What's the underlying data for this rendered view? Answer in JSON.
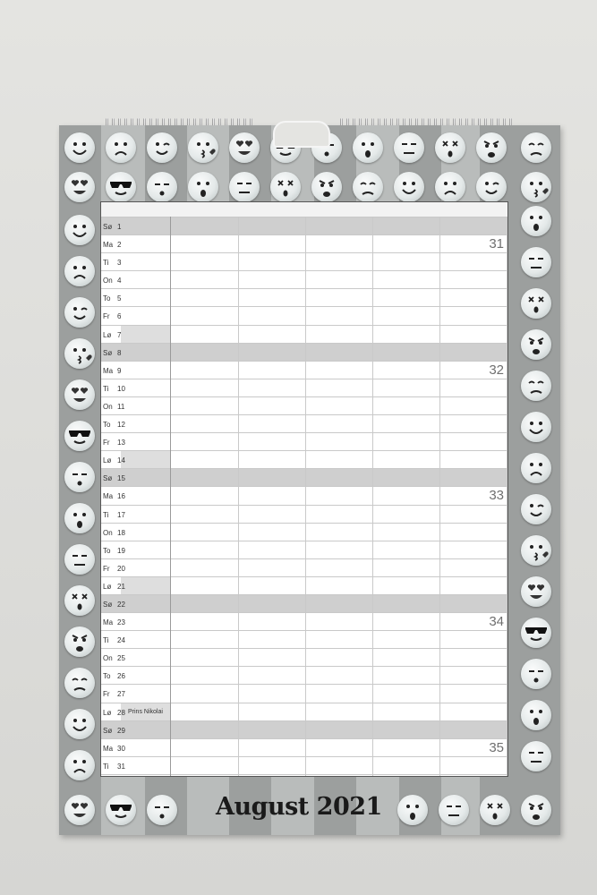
{
  "calendar": {
    "month_title": "August 2021",
    "days": [
      {
        "name": "Sø",
        "num": "1"
      },
      {
        "name": "Ma",
        "num": "2"
      },
      {
        "name": "Ti",
        "num": "3"
      },
      {
        "name": "On",
        "num": "4"
      },
      {
        "name": "To",
        "num": "5"
      },
      {
        "name": "Fr",
        "num": "6"
      },
      {
        "name": "Lø",
        "num": "7"
      },
      {
        "name": "Sø",
        "num": "8"
      },
      {
        "name": "Ma",
        "num": "9"
      },
      {
        "name": "Ti",
        "num": "10"
      },
      {
        "name": "On",
        "num": "11"
      },
      {
        "name": "To",
        "num": "12"
      },
      {
        "name": "Fr",
        "num": "13"
      },
      {
        "name": "Lø",
        "num": "14"
      },
      {
        "name": "Sø",
        "num": "15"
      },
      {
        "name": "Ma",
        "num": "16"
      },
      {
        "name": "Ti",
        "num": "17"
      },
      {
        "name": "On",
        "num": "18"
      },
      {
        "name": "To",
        "num": "19"
      },
      {
        "name": "Fr",
        "num": "20"
      },
      {
        "name": "Lø",
        "num": "21"
      },
      {
        "name": "Sø",
        "num": "22"
      },
      {
        "name": "Ma",
        "num": "23"
      },
      {
        "name": "Ti",
        "num": "24"
      },
      {
        "name": "On",
        "num": "25"
      },
      {
        "name": "To",
        "num": "26"
      },
      {
        "name": "Fr",
        "num": "27"
      },
      {
        "name": "Lø",
        "num": "28",
        "note": "Prins Nikolai"
      },
      {
        "name": "Sø",
        "num": "29"
      },
      {
        "name": "Ma",
        "num": "30"
      },
      {
        "name": "Ti",
        "num": "31"
      }
    ],
    "weeks": [
      {
        "number": "31",
        "starts_at_day": "2"
      },
      {
        "number": "32",
        "starts_at_day": "9"
      },
      {
        "number": "33",
        "starts_at_day": "16"
      },
      {
        "number": "34",
        "starts_at_day": "23"
      },
      {
        "number": "35",
        "starts_at_day": "30"
      }
    ],
    "column_count": 6
  },
  "decor": {
    "emoji_faces": [
      "happy-face-icon",
      "sad-face-icon",
      "wink-face-icon",
      "kiss-face-icon",
      "heart-eyes-face-icon",
      "sunglasses-face-icon",
      "sleepy-face-icon",
      "shocked-face-icon",
      "neutral-face-icon",
      "dizzy-face-icon",
      "angry-face-icon",
      "tearful-face-icon"
    ],
    "colors": {
      "poster_bg": "#b9bcbb",
      "stripe": "#9c9f9e",
      "sunday_row": "#cfcfcf"
    }
  }
}
